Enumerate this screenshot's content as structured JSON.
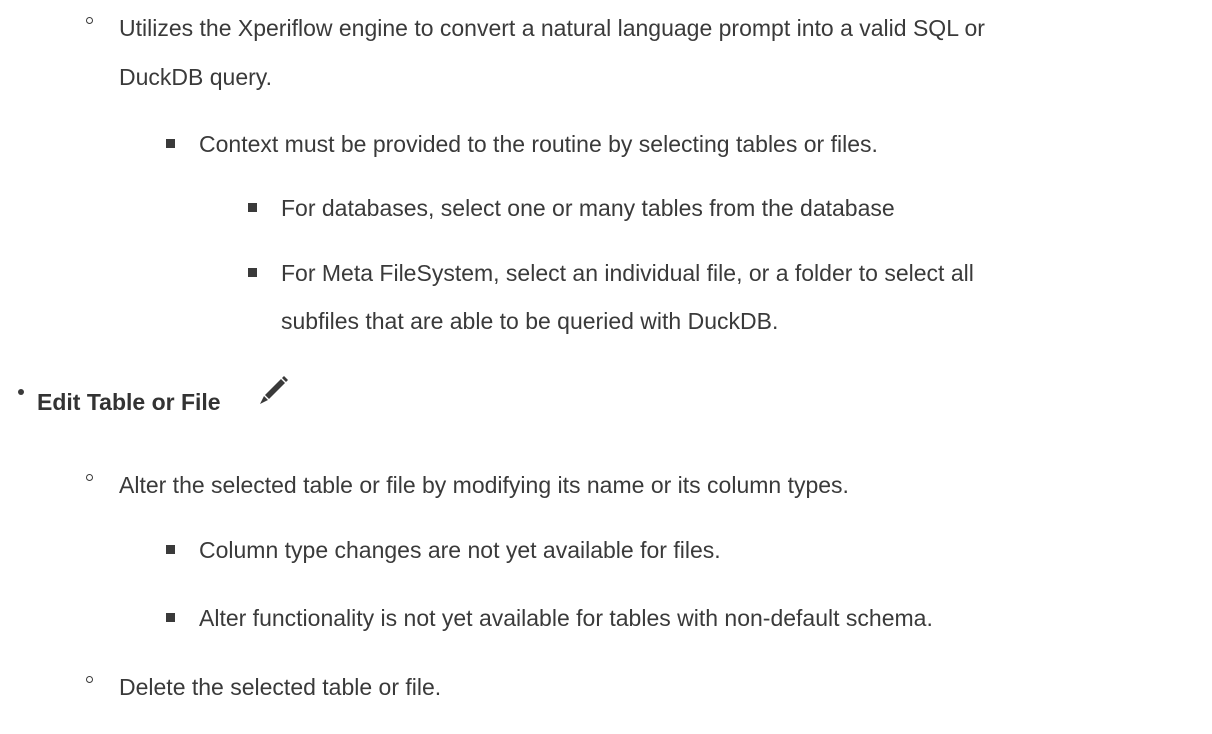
{
  "items": [
    {
      "text": "Utilizes the Xperiflow engine to convert a natural language prompt into a valid SQL or"
    },
    {
      "text": "DuckDB query."
    },
    {
      "text": "Context must be provided to the routine by selecting tables or files."
    },
    {
      "text": "For databases, select one or many tables from the database"
    },
    {
      "text": "For Meta FileSystem, select an individual file, or a folder to select all"
    },
    {
      "text": "subfiles that are able to be queried with DuckDB."
    },
    {
      "text": "Edit Table or File"
    },
    {
      "text": "Alter the selected table or file by modifying its name or its column types."
    },
    {
      "text": "Column type changes are not yet available for files."
    },
    {
      "text": "Alter functionality is not yet available for tables with non-default schema."
    },
    {
      "text": "Delete the selected table or file."
    }
  ],
  "icons": {
    "edit": "pencil-icon"
  }
}
